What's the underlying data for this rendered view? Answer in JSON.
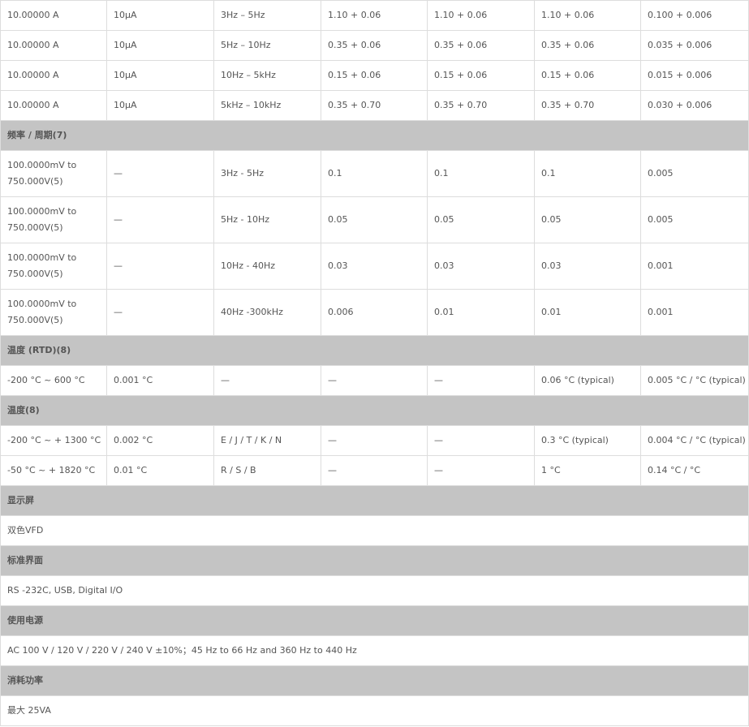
{
  "rows": [
    {
      "kind": "row",
      "cells": [
        "10.00000 A",
        "10μA",
        "3Hz – 5Hz",
        "1.10 + 0.06",
        "1.10 + 0.06",
        "1.10 + 0.06",
        "0.100 + 0.006"
      ]
    },
    {
      "kind": "row",
      "cells": [
        "10.00000 A",
        "10μA",
        "5Hz – 10Hz",
        "0.35 + 0.06",
        "0.35 + 0.06",
        "0.35 + 0.06",
        "0.035 + 0.006"
      ]
    },
    {
      "kind": "row",
      "cells": [
        "10.00000 A",
        "10μA",
        "10Hz – 5kHz",
        "0.15 + 0.06",
        "0.15 + 0.06",
        "0.15 + 0.06",
        "0.015 + 0.006"
      ]
    },
    {
      "kind": "row",
      "cells": [
        "10.00000 A",
        "10μA",
        "5kHz – 10kHz",
        "0.35 + 0.70",
        "0.35 + 0.70",
        "0.35 + 0.70",
        "0.030 + 0.006"
      ]
    },
    {
      "kind": "section",
      "text": "频率 / 周期(7)"
    },
    {
      "kind": "row",
      "tall": true,
      "cells": [
        "100.0000mV to 750.000V(5)",
        "—",
        "3Hz - 5Hz",
        "0.1",
        "0.1",
        "0.1",
        "0.005"
      ]
    },
    {
      "kind": "row",
      "tall": true,
      "cells": [
        "100.0000mV to 750.000V(5)",
        "—",
        "5Hz - 10Hz",
        "0.05",
        "0.05",
        "0.05",
        "0.005"
      ]
    },
    {
      "kind": "row",
      "tall": true,
      "cells": [
        "100.0000mV to 750.000V(5)",
        "—",
        "10Hz - 40Hz",
        "0.03",
        "0.03",
        "0.03",
        "0.001"
      ]
    },
    {
      "kind": "row",
      "tall": true,
      "cells": [
        "100.0000mV to 750.000V(5)",
        "—",
        "40Hz -300kHz",
        "0.006",
        "0.01",
        "0.01",
        "0.001"
      ]
    },
    {
      "kind": "section",
      "text": "温度 (RTD)(8)"
    },
    {
      "kind": "row",
      "cells": [
        "-200 °C ~ 600 °C",
        "0.001 °C",
        "—",
        "—",
        "—",
        "0.06 °C (typical)",
        "0.005 °C / °C (typical)"
      ]
    },
    {
      "kind": "section",
      "text": "温度(8)"
    },
    {
      "kind": "row",
      "cells": [
        "-200 °C ~ + 1300 °C",
        "0.002 °C",
        "E / J / T / K / N",
        "—",
        "—",
        "0.3 °C (typical)",
        "0.004 °C / °C (typical)"
      ]
    },
    {
      "kind": "row",
      "cells": [
        "-50 °C ~ + 1820 °C",
        "0.01 °C",
        "R / S / B",
        "—",
        "—",
        "1 °C",
        "0.14 °C / °C"
      ]
    },
    {
      "kind": "section",
      "text": "显示屏"
    },
    {
      "kind": "full",
      "text": "双色VFD"
    },
    {
      "kind": "section",
      "text": "标准界面"
    },
    {
      "kind": "full",
      "text": "RS -232C, USB, Digital I/O"
    },
    {
      "kind": "section",
      "text": "使用电源"
    },
    {
      "kind": "full",
      "text": "AC 100 V / 120 V / 220 V / 240 V ±10%；45 Hz to 66 Hz and 360 Hz to 440 Hz"
    },
    {
      "kind": "section",
      "text": "消耗功率"
    },
    {
      "kind": "full",
      "text": "最大 25VA"
    }
  ]
}
